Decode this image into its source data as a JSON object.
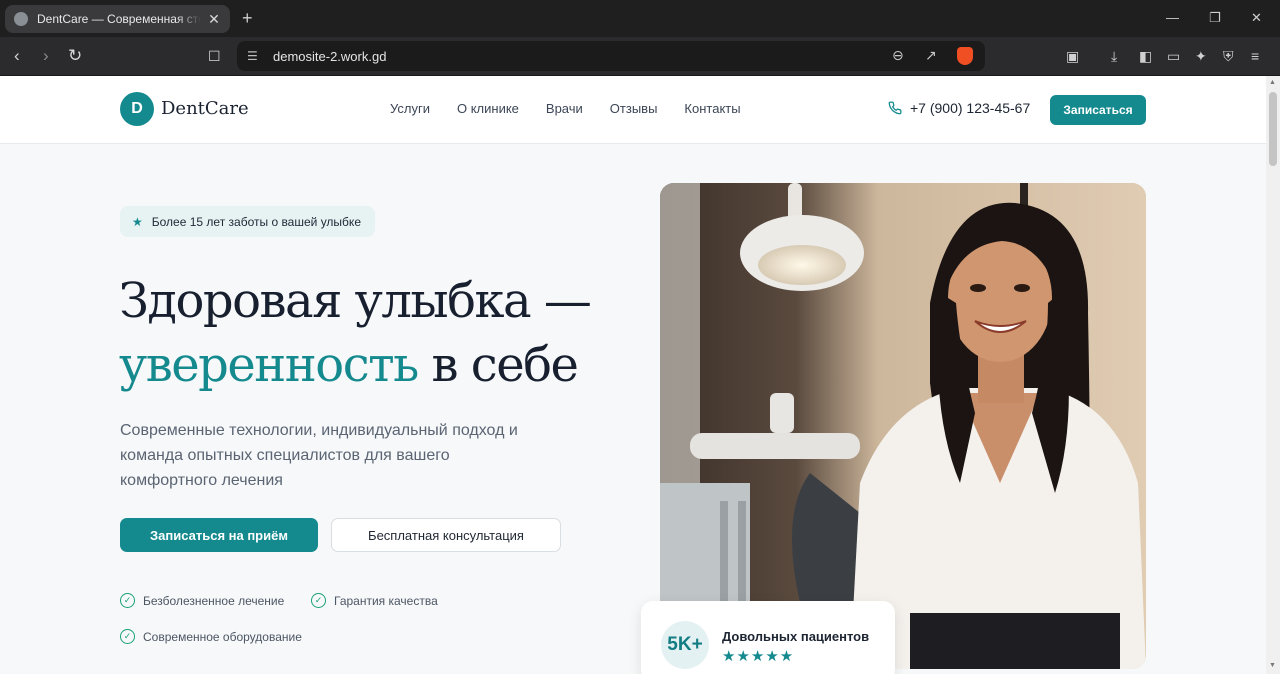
{
  "browser": {
    "tab_title": "DentCare — Современная стоматология",
    "tab_close": "✕",
    "new_tab": "+",
    "url": "demosite-2.work.gd"
  },
  "site": {
    "logo_letter": "D",
    "logo_text": "DentCare",
    "nav": [
      "Услуги",
      "О клинике",
      "Врачи",
      "Отзывы",
      "Контакты"
    ],
    "phone": "+7 (900) 123-45-67",
    "cta_top": "Записаться"
  },
  "hero": {
    "badge": "Более 15 лет заботы о вашей улыбке",
    "title_line1": "Здоровая улыбка —",
    "title_accent": "уверенность",
    "title_rest": " в себе",
    "subtitle": "Современные технологии, индивидуальный подход и команда опытных специалистов для вашего комфортного лечения",
    "btn_primary": "Записаться на приём",
    "btn_secondary": "Бесплатная консультация",
    "features": [
      "Безболезненное лечение",
      "Гарантия качества",
      "Современное оборудование"
    ]
  },
  "stat_card": {
    "value": "5K+",
    "label": "Довольных пациентов",
    "stars": "★★★★★",
    "rating_stars": 5
  },
  "colors": {
    "accent": "#148a8f",
    "check": "#1aa079",
    "heading": "#182030",
    "page_bg": "#f6f8f9"
  }
}
